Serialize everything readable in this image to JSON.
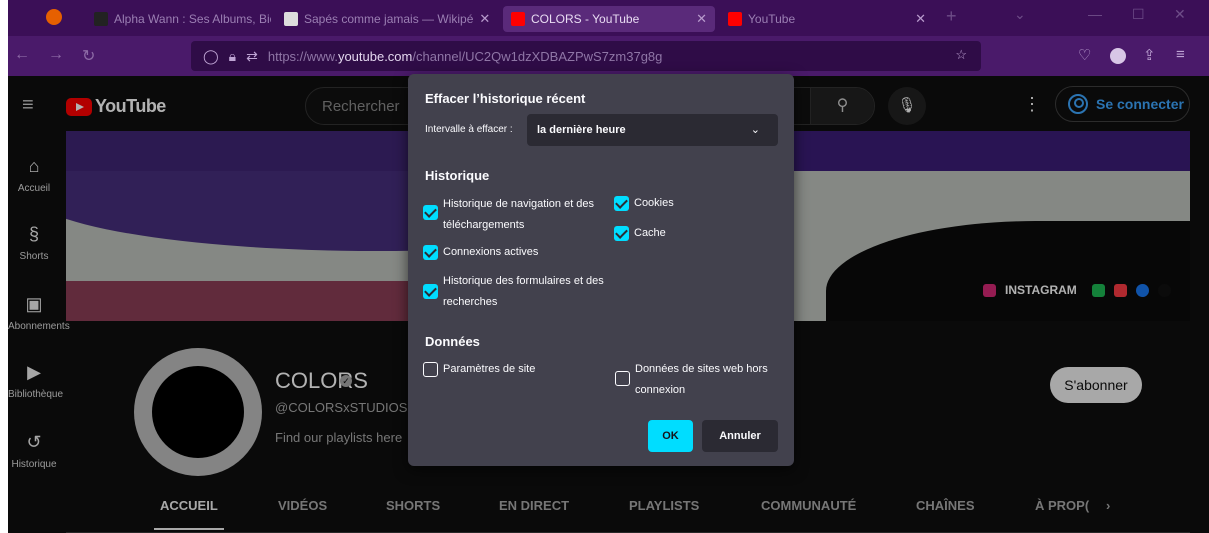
{
  "browser": {
    "tabs": [
      {
        "title": "Alpha Wann : Ses Albums, Biog",
        "active": false
      },
      {
        "title": "Sapés comme jamais — Wikipé",
        "active": false
      },
      {
        "title": "COLORS - YouTube",
        "active": true
      },
      {
        "title": "YouTube",
        "active": false
      }
    ],
    "url": {
      "prefix": "https://www.",
      "host": "youtube.com",
      "path": "/channel/UC2Qw1dzXDBAZPwS7zm37g8g"
    }
  },
  "youtube": {
    "search_placeholder": "Rechercher",
    "signin_label": "Se connecter",
    "rail": [
      {
        "label": "Accueil",
        "icon": "home-icon"
      },
      {
        "label": "Shorts",
        "icon": "shorts-icon"
      },
      {
        "label": "Abonnements",
        "icon": "subscriptions-icon"
      },
      {
        "label": "Bibliothèque",
        "icon": "library-icon"
      },
      {
        "label": "Historique",
        "icon": "history-icon"
      }
    ],
    "banner_link": "INSTAGRAM",
    "channel": {
      "name": "COLORS",
      "handle": "@COLORSxSTUDIOS",
      "description": "Find our playlists here",
      "subscribe": "S'abonner"
    },
    "tabs": [
      "ACCUEIL",
      "VIDÉOS",
      "SHORTS",
      "EN DIRECT",
      "PLAYLISTS",
      "COMMUNAUTÉ",
      "CHAÎNES",
      "À PROP("
    ]
  },
  "dialog": {
    "title": "Effacer l’historique récent",
    "range_label": "Intervalle à effacer :",
    "range_value": "la dernière heure",
    "history_heading": "Historique",
    "history_items": [
      {
        "label": "Historique de navigation et des téléchargements",
        "checked": true
      },
      {
        "label": "Cookies",
        "checked": true
      },
      {
        "label": "Cache",
        "checked": true
      },
      {
        "label": "Connexions actives",
        "checked": true
      },
      {
        "label": "Historique des formulaires et des recherches",
        "checked": true
      }
    ],
    "data_heading": "Données",
    "data_items": [
      {
        "label": "Paramètres de site",
        "checked": false
      },
      {
        "label": "Données de sites web hors connexion",
        "checked": false
      }
    ],
    "ok_label": "OK",
    "cancel_label": "Annuler",
    "colors": {
      "accent": "#00ddff",
      "surface": "#42414d",
      "field": "#2b2a33"
    }
  }
}
